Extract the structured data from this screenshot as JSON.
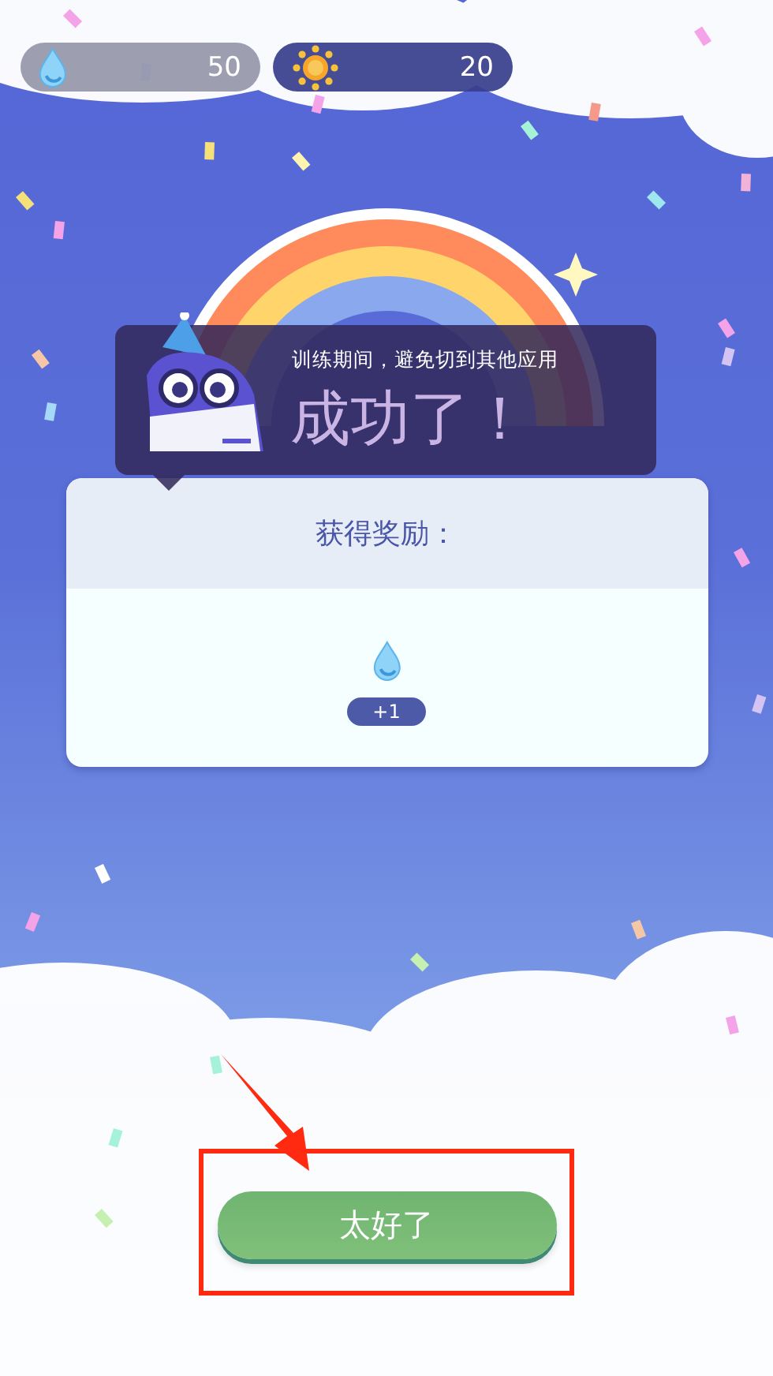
{
  "resources": [
    {
      "kind": "water",
      "value": "50"
    },
    {
      "kind": "sun",
      "value": "20"
    }
  ],
  "title": "成功了！",
  "tip": {
    "text": "训练期间，避免切到其他应用"
  },
  "reward": {
    "heading": "获得奖励：",
    "items": [
      {
        "kind": "water",
        "amount": "+1"
      }
    ]
  },
  "confirm_button": {
    "label": "太好了"
  }
}
